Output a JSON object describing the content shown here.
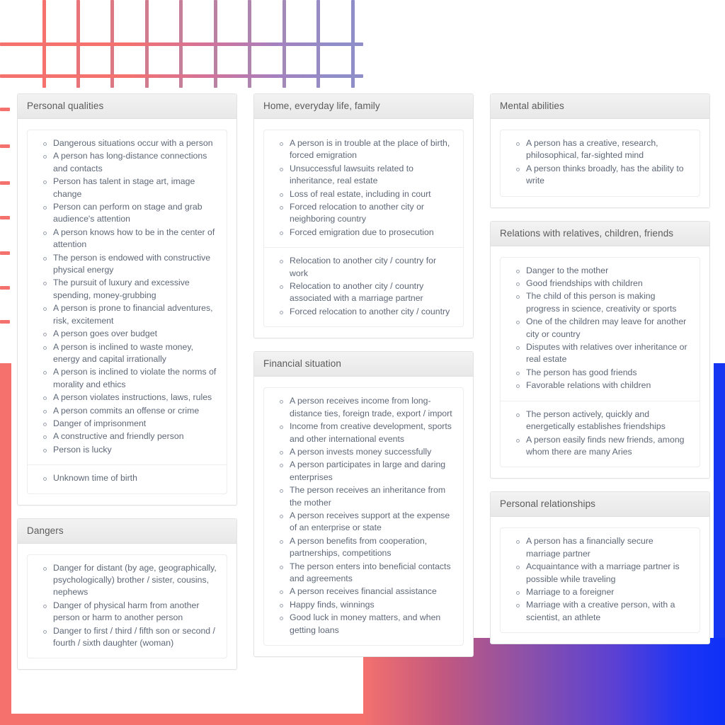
{
  "decor": {
    "grid_line_color_start": "#f4716e",
    "grid_line_color_end": "#8f8ec9",
    "left_band_color": "#f4716e",
    "right_band_color": "#1535f2",
    "gradient_from": "#f4716e",
    "gradient_to": "#0d30f7"
  },
  "columns": [
    {
      "id": "column-left",
      "panels": [
        {
          "title": "Personal qualities",
          "sections": [
            {
              "items": [
                "Dangerous situations occur with a person",
                "A person has long-distance connections and contacts",
                "Person has talent in stage art, image change",
                "Person can perform on stage and grab audience's attention",
                "A person knows how to be in the center of attention",
                "The person is endowed with constructive physical energy",
                "The pursuit of luxury and excessive spending, money-grubbing",
                "A person is prone to financial adventures, risk, excitement",
                "A person goes over budget",
                "A person is inclined to waste money, energy and capital irrationally",
                "A person is inclined to violate the norms of morality and ethics",
                "A person violates instructions, laws, rules",
                "A person commits an offense or crime",
                "Danger of imprisonment",
                "A constructive and friendly person",
                "Person is lucky"
              ]
            },
            {
              "items": [
                "Unknown time of birth"
              ]
            }
          ]
        },
        {
          "title": "Dangers",
          "sections": [
            {
              "items": [
                "Danger for distant (by age, geographically, psychologically) brother / sister, cousins, nephews",
                "Danger of physical harm from another person or harm to another person",
                "Danger to first / third / fifth son or second / fourth / sixth daughter (woman)"
              ]
            }
          ]
        }
      ]
    },
    {
      "id": "column-middle",
      "panels": [
        {
          "title": "Home, everyday life, family",
          "sections": [
            {
              "items": [
                "A person is in trouble at the place of birth, forced emigration",
                "Unsuccessful lawsuits related to inheritance, real estate",
                "Loss of real estate, including in court",
                "Forced relocation to another city or neighboring country",
                "Forced emigration due to prosecution"
              ]
            },
            {
              "items": [
                "Relocation to another city / country for work",
                "Relocation to another city / country associated with a marriage partner",
                "Forced relocation to another city / country"
              ]
            }
          ]
        },
        {
          "title": "Financial situation",
          "sections": [
            {
              "items": [
                "A person receives income from long-distance ties, foreign trade, export / import",
                "Income from creative development, sports and other international events",
                "A person invests money successfully",
                "A person participates in large and daring enterprises",
                "The person receives an inheritance from the mother",
                "A person receives support at the expense of an enterprise or state",
                "A person benefits from cooperation, partnerships, competitions",
                "The person enters into beneficial contacts and agreements",
                "A person receives financial assistance",
                "Happy finds, winnings",
                "Good luck in money matters, and when getting loans"
              ]
            }
          ]
        }
      ]
    },
    {
      "id": "column-right",
      "panels": [
        {
          "title": "Mental abilities",
          "sections": [
            {
              "items": [
                "A person has a creative, research, philosophical, far-sighted mind",
                "A person thinks broadly, has the ability to write"
              ]
            }
          ]
        },
        {
          "title": "Relations with relatives, children, friends",
          "sections": [
            {
              "items": [
                "Danger to the mother",
                "Good friendships with children",
                "The child of this person is making progress in science, creativity or sports",
                "One of the children may leave for another city or country",
                "Disputes with relatives over inheritance or real estate",
                "The person has good friends",
                "Favorable relations with children"
              ]
            },
            {
              "items": [
                "The person actively, quickly and energetically establishes friendships",
                "A person easily finds new friends, among whom there are many Aries"
              ]
            }
          ]
        },
        {
          "title": "Personal relationships",
          "sections": [
            {
              "items": [
                "A person has a financially secure marriage partner",
                "Acquaintance with a marriage partner is possible while traveling",
                "Marriage to a foreigner",
                "Marriage with a creative person, with a scientist, an athlete"
              ]
            }
          ]
        }
      ]
    }
  ]
}
